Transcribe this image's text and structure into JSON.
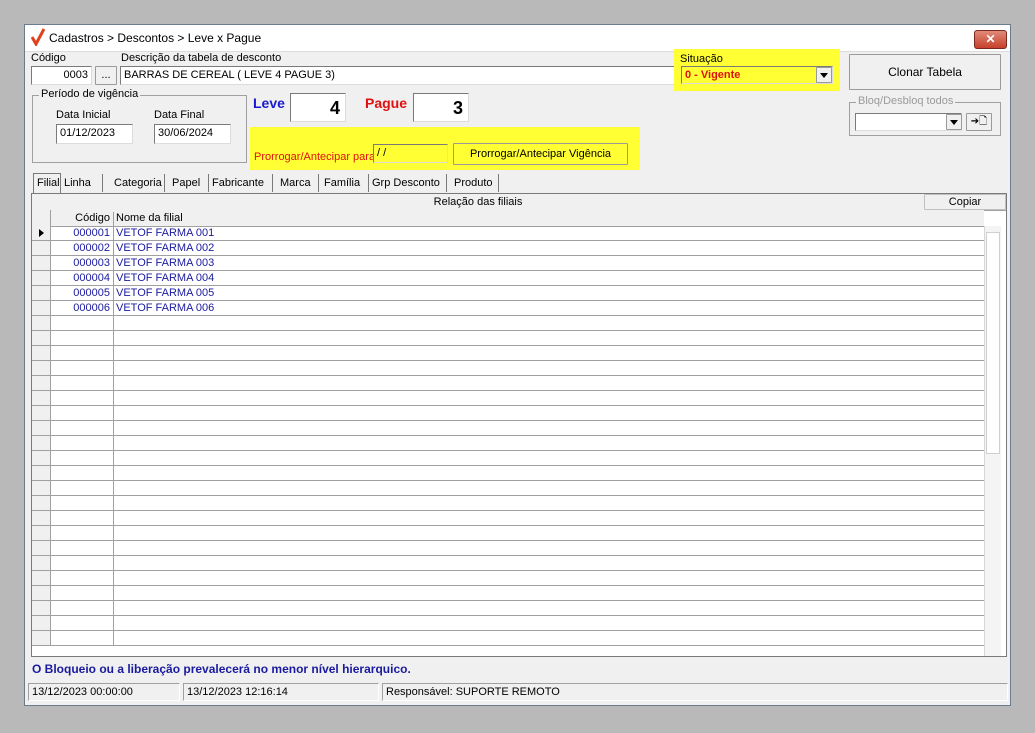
{
  "window": {
    "title": "Cadastros > Descontos > Leve x Pague",
    "close_label": "✕"
  },
  "form": {
    "codigo_label": "Código",
    "codigo_value": "0003",
    "lookup_label": "...",
    "descricao_label": "Descrição da tabela de desconto",
    "descricao_value": "BARRAS DE CEREAL ( LEVE 4 PAGUE 3)",
    "situacao_label": "Situação",
    "situacao_value": "0 - Vigente",
    "clonar_label": "Clonar Tabela",
    "bloq_label": "Bloq/Desbloq todos",
    "bloq_action": "➔🗋",
    "periodo_label": "Período de vigência",
    "data_inicial_label": "Data Inicial",
    "data_inicial_value": "01/12/2023",
    "data_final_label": "Data Final",
    "data_final_value": "30/06/2024",
    "leve_label": "Leve",
    "leve_value": "4",
    "pague_label": "Pague",
    "pague_value": "3",
    "prorrogar_label": "Prorrogar/Antecipar para:",
    "prorrogar_value": " / /",
    "prorrogar_button": "Prorrogar/Antecipar Vigência"
  },
  "tabs": [
    "Filial",
    "Linha",
    "Categoria",
    "Papel",
    "Fabricante",
    "Marca",
    "Família",
    "Grp Desconto",
    "Produto"
  ],
  "grid": {
    "title": "Relação das filiais",
    "copiar_label": "Copiar",
    "columns": [
      "Código",
      "Nome da filial"
    ],
    "rows": [
      {
        "codigo": "000001",
        "nome": "VETOF FARMA 001"
      },
      {
        "codigo": "000002",
        "nome": "VETOF FARMA 002"
      },
      {
        "codigo": "000003",
        "nome": "VETOF FARMA 003"
      },
      {
        "codigo": "000004",
        "nome": "VETOF FARMA 004"
      },
      {
        "codigo": "000005",
        "nome": "VETOF FARMA 005"
      },
      {
        "codigo": "000006",
        "nome": "VETOF FARMA 006"
      }
    ]
  },
  "note": "O Bloqueio ou a liberação prevalecerá no menor nível hierarquico.",
  "status": {
    "created": "13/12/2023 00:00:00",
    "modified": "13/12/2023 12:16:14",
    "responsavel": "Responsável: SUPORTE REMOTO"
  },
  "colors": {
    "highlight": "#ffff33",
    "leve": "#1a1ad0",
    "pague": "#e01010",
    "link_text": "#1a1aa0"
  }
}
